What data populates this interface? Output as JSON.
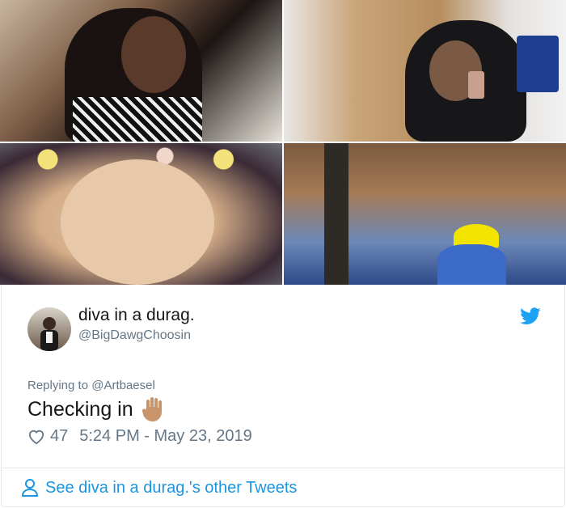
{
  "tweet": {
    "display_name": "diva in a durag.",
    "handle": "@BigDawgChoosin",
    "replying_prefix": "Replying to ",
    "replying_to": "@Artbaesel",
    "text": "Checking in",
    "likes": "47",
    "timestamp": "5:24 PM - May 23, 2019",
    "footer_link": "See diva in a durag.'s other Tweets"
  },
  "photos": [
    {
      "icon": "selfie-photo"
    },
    {
      "icon": "mirror-selfie-photo"
    },
    {
      "icon": "closeup-selfie-photo"
    },
    {
      "icon": "classroom-selfie-photo"
    }
  ],
  "colors": {
    "link": "#1b95e0",
    "secondary_text": "#657786",
    "twitter_blue": "#1da1f2",
    "border": "#e1e8ed"
  },
  "icons": [
    "twitter-bird-icon",
    "heart-icon",
    "person-icon",
    "raised-hand-emoji"
  ]
}
